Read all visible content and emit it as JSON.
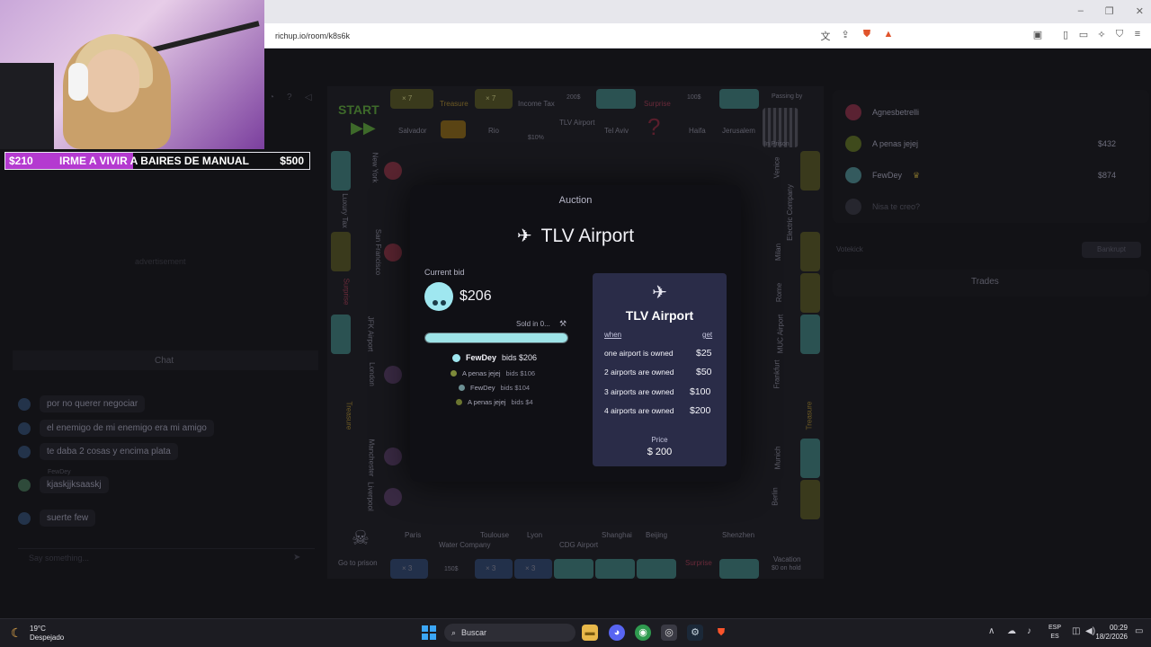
{
  "browser": {
    "url": "richup.io/room/k8s6k",
    "window_controls": [
      "–",
      "❐",
      "✕"
    ]
  },
  "stream_overlay": {
    "left_amount": "$210",
    "goal_text": "IRME A VIVIR A BAIRES DE MANUAL",
    "right_amount": "$500",
    "progress": 0.42
  },
  "left_panel": {
    "advertisement": "advertisement",
    "chat_title": "Chat",
    "messages": [
      {
        "name": "",
        "text": "por no querer negociar"
      },
      {
        "name": "",
        "text": "el enemigo de mi enemigo era mi amigo"
      },
      {
        "name": "",
        "text": "te daba 2 cosas y encima plata"
      },
      {
        "name": "FewDey",
        "text": "kjaskjjksaaskj"
      },
      {
        "name": "",
        "text": "suerte few"
      }
    ],
    "chat_placeholder": "Say something..."
  },
  "board": {
    "start_label": "START",
    "top_row": [
      "Salvador",
      "Treasure",
      "Rio",
      "Income Tax",
      "TLV Airport",
      "Tel Aviv",
      "Surprise",
      "Haifa",
      "Jerusalem",
      "In Prison"
    ],
    "top_prices": [
      "",
      "",
      "",
      "$10%",
      "200$",
      "",
      "",
      "100$",
      "",
      ""
    ],
    "left_col": [
      "New York",
      "Luxury Tax",
      "San Francisco",
      "Surprise",
      "JFK Airport",
      "London",
      "Treasure",
      "Manchester",
      "Liverpool"
    ],
    "right_col": [
      "Venice",
      "Electric Company",
      "Milan",
      "Rome",
      "MUC Airport",
      "Frankfurt",
      "Treasure",
      "Munich",
      "Berlin"
    ],
    "bottom_row": [
      "Go to prison",
      "Paris",
      "Water Company",
      "Toulouse",
      "Lyon",
      "CDG Airport",
      "Shanghai",
      "Beijing",
      "Surprise",
      "Shenzhen",
      "Vacation"
    ],
    "bottom_sub": [
      "",
      "",
      "150$",
      "",
      "",
      "",
      "",
      "",
      "",
      "",
      "$0 on hold"
    ],
    "houses_top": [
      "× 7",
      "× 7"
    ],
    "houses_bottom": [
      "× 3",
      "× 3",
      "× 3"
    ],
    "passing_by": "Passing by"
  },
  "players": [
    {
      "name": "Agnesbetrelli",
      "money": "",
      "color": "#e2447a"
    },
    {
      "name": "A penas jejej",
      "money": "$432",
      "color": "#a7c33a"
    },
    {
      "name": "FewDey",
      "money": "$874",
      "color": "#8fd9df"
    },
    {
      "name": "Nisa te creo?",
      "money": "",
      "color": "#6c6c78"
    }
  ],
  "right_panel": {
    "votekick": "Votekick",
    "bankrupt": "Bankrupt",
    "trades": "Trades"
  },
  "auction": {
    "title": "Auction",
    "property": "TLV Airport",
    "current_bid_label": "Current bid",
    "current_bid": "$206",
    "sold_in": "Sold in 0...",
    "timer_progress": 1.0,
    "bids": [
      {
        "name": "FewDey",
        "text": "bids $206",
        "color": "#9fe7f0",
        "highlight": true
      },
      {
        "name": "A penas jejej",
        "text": "bids $106",
        "color": "#a7c33a",
        "highlight": false
      },
      {
        "name": "FewDey",
        "text": "bids $104",
        "color": "#9fe7f0",
        "highlight": false
      },
      {
        "name": "A penas jejej",
        "text": "bids $4",
        "color": "#a7c33a",
        "highlight": false
      }
    ]
  },
  "rent_card": {
    "title": "TLV Airport",
    "col_when": "when",
    "col_get": "get",
    "rows": [
      {
        "cond": "one airport is owned",
        "value": "$25"
      },
      {
        "cond": "2 airports are owned",
        "value": "$50"
      },
      {
        "cond": "3 airports are owned",
        "value": "$100"
      },
      {
        "cond": "4 airports are owned",
        "value": "$200"
      }
    ],
    "price_label": "Price",
    "price": "$ 200"
  },
  "taskbar": {
    "temperature": "19°C",
    "weather": "Despejado",
    "search_placeholder": "Buscar",
    "lang_top": "ESP",
    "lang_bottom": "ES",
    "time": "00:29",
    "date": "18/2/2026"
  }
}
